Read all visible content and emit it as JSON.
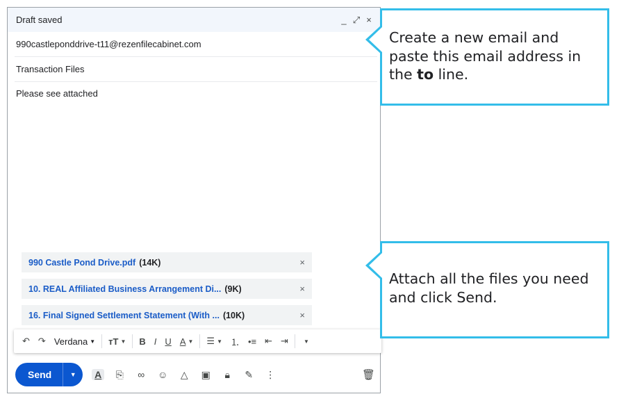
{
  "compose": {
    "title": "Draft saved",
    "controls": {
      "minimize": "_",
      "popout": "⤢",
      "close": "×"
    },
    "to": "990castleponddrive-t11@rezenfilecabinet.com",
    "subject": "Transaction Files",
    "body": "Please see attached",
    "attachments": [
      {
        "name": "990 Castle Pond Drive.pdf",
        "size": "(14K)"
      },
      {
        "name": "10. REAL Affiliated Business Arrangement Di...",
        "size": "(9K)"
      },
      {
        "name": "16. Final Signed Settlement Statement (With ...",
        "size": "(10K)"
      }
    ],
    "toolbar": {
      "font": "Verdana"
    },
    "send_label": "Send"
  },
  "callouts": [
    {
      "text_before": "Create a new email and paste this email address in the ",
      "bold": "to",
      "text_after": " line."
    },
    {
      "text": "Attach all the files you need and click Send."
    }
  ]
}
